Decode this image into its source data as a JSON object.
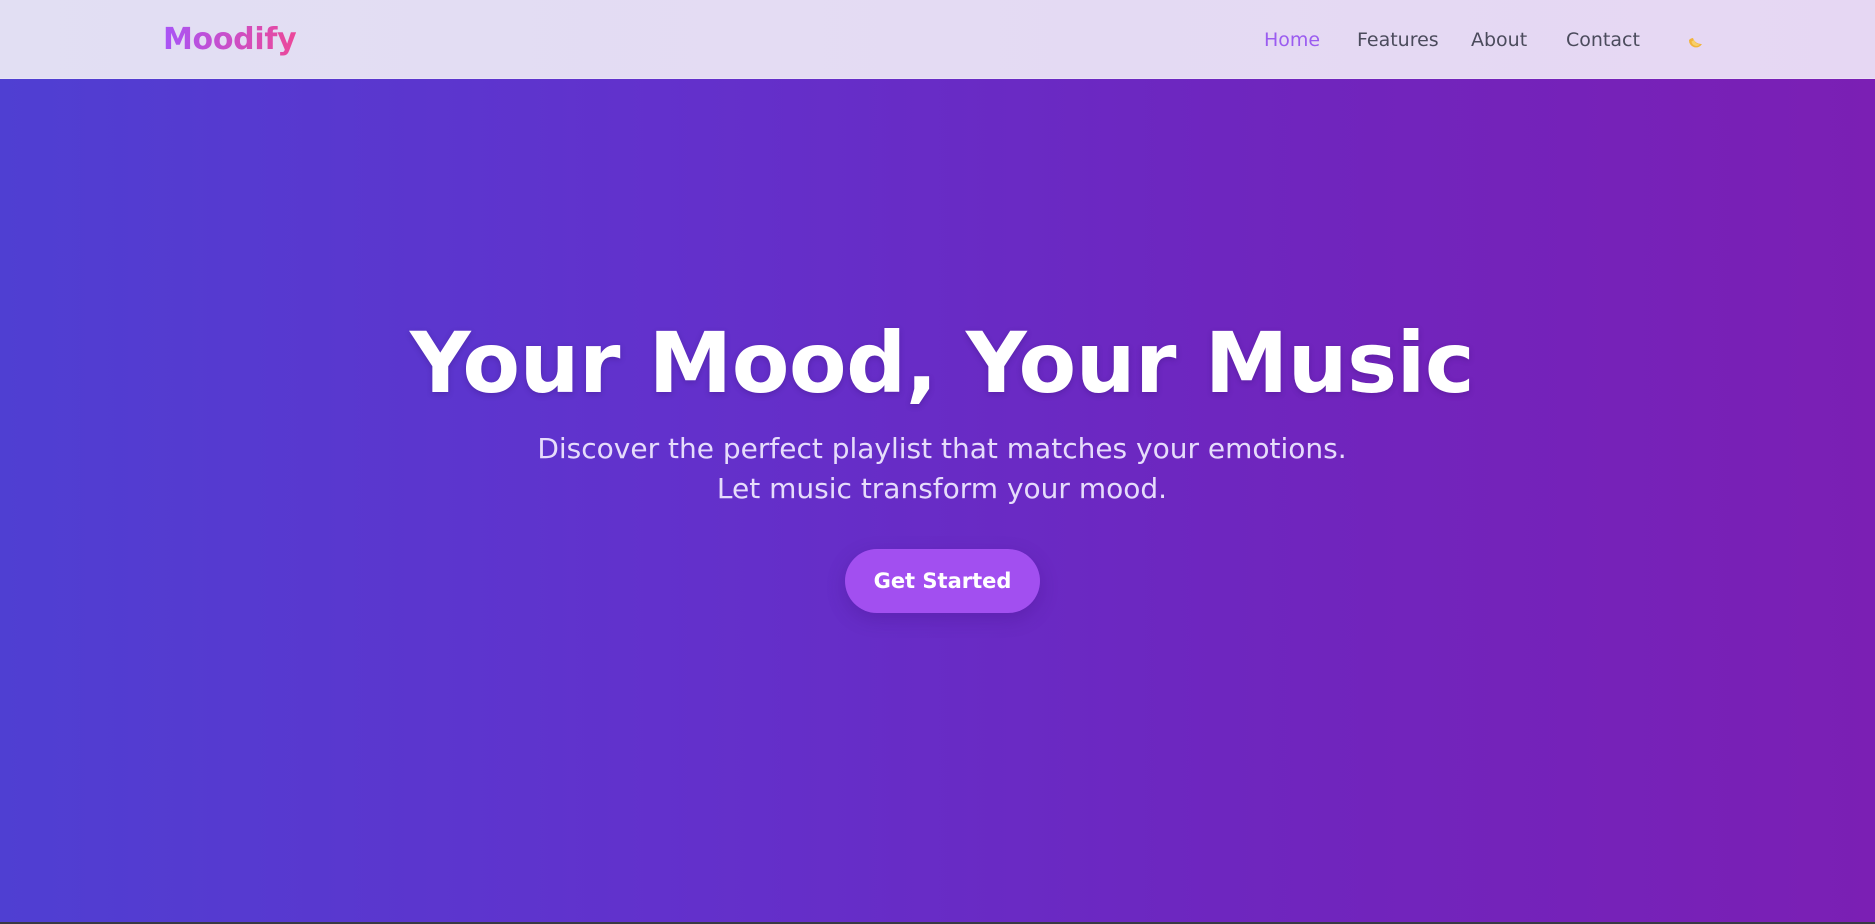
{
  "header": {
    "logo": "Moodify",
    "nav": [
      {
        "label": "Home",
        "active": true
      },
      {
        "label": "Features",
        "active": false
      },
      {
        "label": "About",
        "active": false
      },
      {
        "label": "Contact",
        "active": false
      }
    ],
    "theme_toggle_icon": "moon-icon"
  },
  "hero": {
    "title": "Your Mood, Your Music",
    "subtitle": "Discover the perfect playlist that matches your emotions. Let music transform your mood.",
    "cta_label": "Get Started"
  },
  "colors": {
    "brand_gradient_start": "#a855f7",
    "brand_gradient_end": "#ec4899",
    "hero_gradient_start": "#4f3fd2",
    "hero_gradient_end": "#7b1fb4",
    "nav_active": "#9b5cf0",
    "nav_text": "#4b4b5c",
    "cta_background": "#a24ff0",
    "moon_icon": "#f2b43a"
  }
}
